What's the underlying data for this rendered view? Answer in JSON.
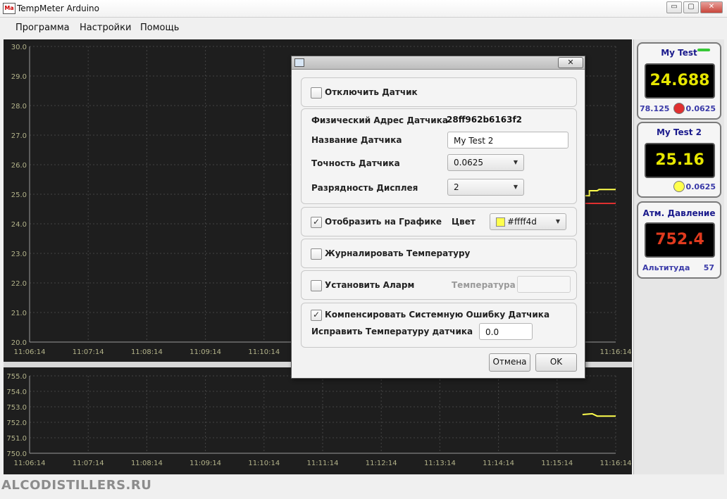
{
  "window": {
    "title": "TempMeter Arduino",
    "icon_text": "Ma",
    "minimize": "▭",
    "maximize": "▢",
    "close": "✕"
  },
  "menu": [
    "Программа",
    "Настройки",
    "Помощь"
  ],
  "chart_data": [
    {
      "type": "line",
      "ylim": [
        20.0,
        30.0
      ],
      "yticks": [
        "30.0",
        "29.0",
        "28.0",
        "27.0",
        "26.0",
        "25.0",
        "24.0",
        "23.0",
        "22.0",
        "21.0",
        "20.0"
      ],
      "xticks": [
        "11:06:14",
        "11:07:14",
        "11:08:14",
        "11:09:14",
        "11:10:14",
        "11:16:14"
      ],
      "series": [
        {
          "color": "#ffff4d",
          "points": [
            [
              "11:15:40",
              24.95
            ],
            [
              "11:15:47",
              24.95
            ],
            [
              "11:15:47",
              25.12
            ],
            [
              "11:15:55",
              25.12
            ],
            [
              "11:15:57",
              25.16
            ],
            [
              "11:16:14",
              25.16
            ]
          ]
        },
        {
          "color": "#e03030",
          "points": [
            [
              "11:15:40",
              24.69
            ],
            [
              "11:16:14",
              24.69
            ]
          ]
        }
      ]
    },
    {
      "type": "line",
      "ylim": [
        750.0,
        755.0
      ],
      "yticks": [
        "755.0",
        "754.0",
        "753.0",
        "752.0",
        "751.0",
        "750.0"
      ],
      "xticks": [
        "11:06:14",
        "11:07:14",
        "11:08:14",
        "11:09:14",
        "11:10:14",
        "11:11:14",
        "11:12:14",
        "11:13:14",
        "11:14:14",
        "11:15:14",
        "11:16:14"
      ],
      "series": [
        {
          "color": "#ffff4d",
          "points": [
            [
              "11:15:40",
              752.5
            ],
            [
              "11:15:50",
              752.55
            ],
            [
              "11:15:55",
              752.4
            ],
            [
              "11:16:14",
              752.4
            ]
          ]
        }
      ]
    }
  ],
  "sensors": [
    {
      "title": "My Test",
      "value": "24.688",
      "left_value": "78.125",
      "right_value": "0.0625",
      "dot_color": "#e03030",
      "value_color": "#e6e600"
    },
    {
      "title": "My Test 2",
      "value": "25.16",
      "right_value": "0.0625",
      "dot_color": "#ffff4d",
      "value_color": "#e6e600"
    },
    {
      "title": "Атм. Давление",
      "value": "752.4",
      "left_value": "Альтитуда",
      "right_value": "57",
      "value_color": "#e03a1e"
    }
  ],
  "watermark": "ALCODISTILLERS.RU",
  "dialog": {
    "close": "✕",
    "disable_sensor": "Отключить Датчик",
    "phys_addr_label": "Физический Адрес Датчика",
    "phys_addr_value": "28ff962b6163f2",
    "name_label": "Название Датчика",
    "name_value": "My Test 2",
    "accuracy_label": "Точность Датчика",
    "accuracy_value": "0.0625",
    "digits_label": "Разрядность Дисплея",
    "digits_value": "2",
    "show_on_chart": "Отобразить на Графике",
    "color_label": "Цвет",
    "color_value": "#ffff4d",
    "log_temp": "Журналировать Температуру",
    "set_alarm": "Установить Аларм",
    "alarm_temp_label": "Температура",
    "compensate": "Компенсировать Системную Ошибку Датчика",
    "correct_label": "Исправить Температуру датчика",
    "correct_value": "0.0",
    "cancel": "Отмена",
    "ok": "OK"
  }
}
